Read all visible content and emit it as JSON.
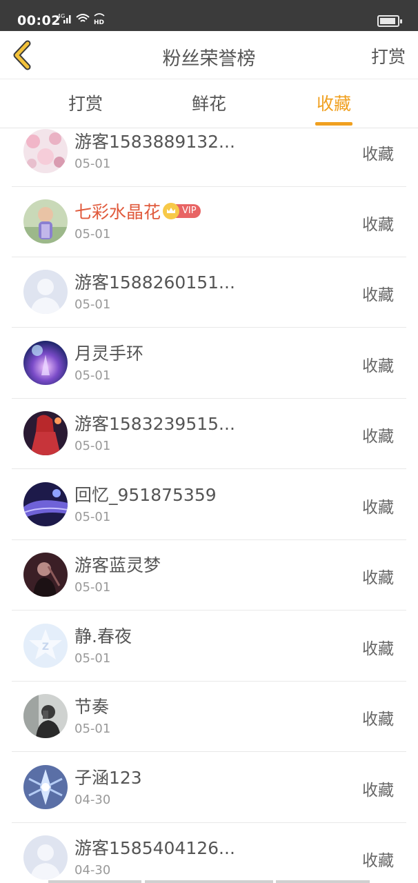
{
  "status_bar": {
    "time": "00:02",
    "network": "4G",
    "hd": "HD"
  },
  "navbar": {
    "title": "粉丝荣誉榜",
    "right_label": "打赏"
  },
  "tabs": [
    {
      "label": "打赏",
      "active": false
    },
    {
      "label": "鲜花",
      "active": false
    },
    {
      "label": "收藏",
      "active": true
    }
  ],
  "colors": {
    "accent": "#f0a020",
    "vip_name": "#e05a3c",
    "text": "#555555",
    "subtext": "#999999"
  },
  "list": [
    {
      "name": "游客1583889132...",
      "date": "05-01",
      "action": "收藏",
      "avatar": "pink-blossom",
      "vip": false
    },
    {
      "name": "七彩水晶花",
      "date": "05-01",
      "action": "收藏",
      "avatar": "child-photo",
      "vip": true,
      "vip_label": "VIP"
    },
    {
      "name": "游客1588260151...",
      "date": "05-01",
      "action": "收藏",
      "avatar": "default-user",
      "vip": false
    },
    {
      "name": "月灵手环",
      "date": "05-01",
      "action": "收藏",
      "avatar": "purple-fantasy",
      "vip": false
    },
    {
      "name": "游客1583239515...",
      "date": "05-01",
      "action": "收藏",
      "avatar": "red-anime",
      "vip": false
    },
    {
      "name": "回忆_951875359",
      "date": "05-01",
      "action": "收藏",
      "avatar": "blue-scene",
      "vip": false
    },
    {
      "name": "游客蓝灵梦",
      "date": "05-01",
      "action": "收藏",
      "avatar": "dark-portrait",
      "vip": false
    },
    {
      "name": "静.春夜",
      "date": "05-01",
      "action": "收藏",
      "avatar": "qq-default",
      "vip": false
    },
    {
      "name": "节奏",
      "date": "05-01",
      "action": "收藏",
      "avatar": "mirror-selfie",
      "vip": false
    },
    {
      "name": "子涵123",
      "date": "04-30",
      "action": "收藏",
      "avatar": "ice-crystal",
      "vip": false
    },
    {
      "name": "游客1585404126...",
      "date": "04-30",
      "action": "收藏",
      "avatar": "default-user",
      "vip": false
    }
  ]
}
